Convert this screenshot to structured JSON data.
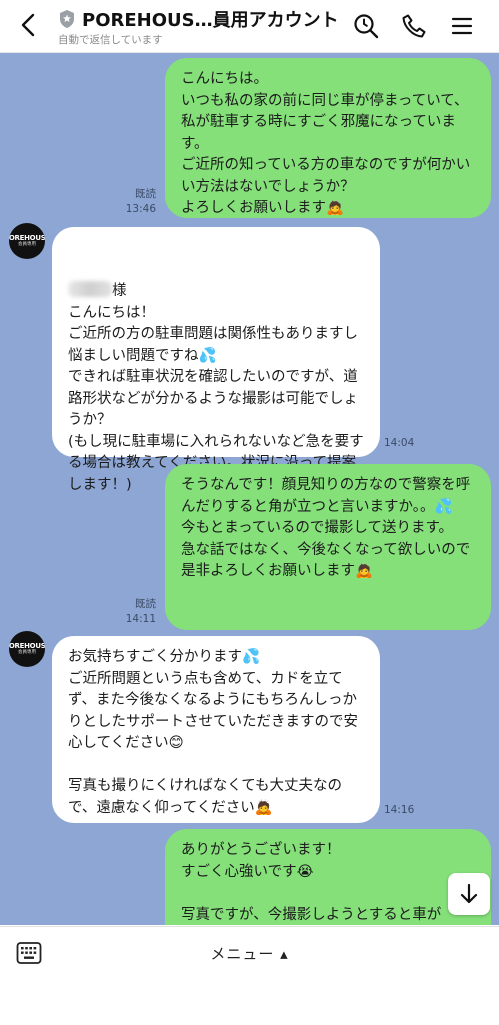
{
  "header": {
    "title": "POREHOUS…員用アカウント",
    "subtitle": "自動で返信しています"
  },
  "avatar": {
    "line1": "POREHOUSE",
    "line2": "会員専用"
  },
  "messages": [
    {
      "side": "out",
      "text": "こんにちは。\nいつも私の家の前に同じ車が停まっていて、私が駐車する時にすごく邪魔になっています。\nご近所の知っている方の車なのですが何かいい方法はないでしょうか？\nよろしくお願いします🙇",
      "read": "既読",
      "time": "13:46"
    },
    {
      "side": "in",
      "name_suffix": "様",
      "text": "こんにちは！\nご近所の方の駐車問題は関係性もありますし悩ましい問題ですね💦\nできれば駐車状況を確認したいのですが、道路形状などが分かるような撮影は可能でしょうか？\n(もし現に駐車場に入れられないなど急を要する場合は教えてください。状況に沿って提案します！)",
      "time": "14:04"
    },
    {
      "side": "out",
      "text": "そうなんです！顔見知りの方なので警察を呼んだりすると角が立つと言いますか。。💦\n今もとまっているので撮影して送ります。\n急な話ではなく、今後なくなって欲しいので是非よろしくお願いします🙇",
      "read": "既読",
      "time": "14:11"
    },
    {
      "side": "in",
      "text": "お気持ちすごく分かります💦\nご近所問題という点も含めて、カドを立てず、また今後なくなるようにもちろんしっかりとしたサポートさせていただきますので安心してください😊\n\n写真も撮りにくければなくても大丈夫なので、遠慮なく仰ってください🙇",
      "time": "14:16"
    },
    {
      "side": "out",
      "text": "ありがとうございます！\nすごく心強いです😭\n\n写真ですが、今撮影しようとすると車が"
    }
  ],
  "bottom": {
    "menu_label": "メニュー ▴"
  },
  "colors": {
    "chat_bg": "#8da6d3",
    "outgoing": "#85e07a",
    "incoming": "#ffffff"
  }
}
